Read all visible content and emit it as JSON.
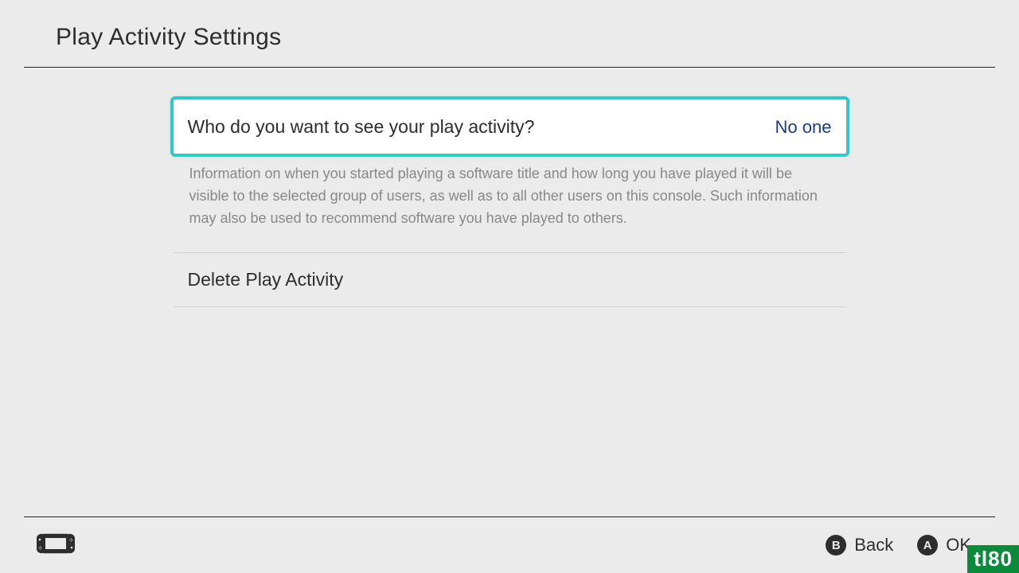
{
  "header": {
    "title": "Play Activity Settings"
  },
  "settings": {
    "visibility": {
      "label": "Who do you want to see your play activity?",
      "value": "No one"
    },
    "description": "Information on when you started playing a software title and how long you have played it will be visible to the selected group of users, as well as to all other users on this console. Such information may also be used to recommend software you have played to others.",
    "delete": {
      "label": "Delete Play Activity"
    }
  },
  "footer": {
    "back": {
      "button": "B",
      "label": "Back"
    },
    "ok": {
      "button": "A",
      "label": "OK"
    }
  },
  "watermark": "tl80"
}
